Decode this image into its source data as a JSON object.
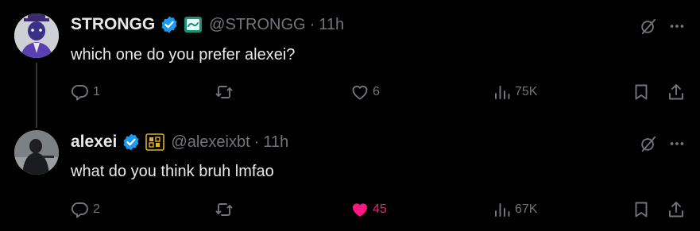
{
  "colors": {
    "background": "#000000",
    "primary_text": "#e7e9ea",
    "secondary_text": "#71767b",
    "verified_blue": "#1d9bf0",
    "like_pink": "#f91880",
    "divider": "#333639"
  },
  "tweets": [
    {
      "name": "STRONGG",
      "handle": "@STRONGG",
      "separator": "·",
      "time": "11h",
      "text": "which one do you prefer alexei?",
      "replies": "1",
      "likes": "6",
      "liked": false,
      "views": "75K",
      "icons": [
        "verified-badge-icon",
        "affiliate-badge-icon",
        "grok-icon",
        "more-icon",
        "reply-icon",
        "repost-icon",
        "like-icon",
        "views-icon",
        "bookmark-icon",
        "share-icon"
      ]
    },
    {
      "name": "alexei",
      "handle": "@alexeixbt",
      "separator": "·",
      "time": "11h",
      "text": "what do you think bruh lmfao",
      "replies": "2",
      "likes": "45",
      "liked": true,
      "views": "67K",
      "icons": [
        "verified-badge-icon",
        "affiliate-badge-icon",
        "grok-icon",
        "more-icon",
        "reply-icon",
        "repost-icon",
        "like-filled-icon",
        "views-icon",
        "bookmark-icon",
        "share-icon"
      ]
    }
  ]
}
